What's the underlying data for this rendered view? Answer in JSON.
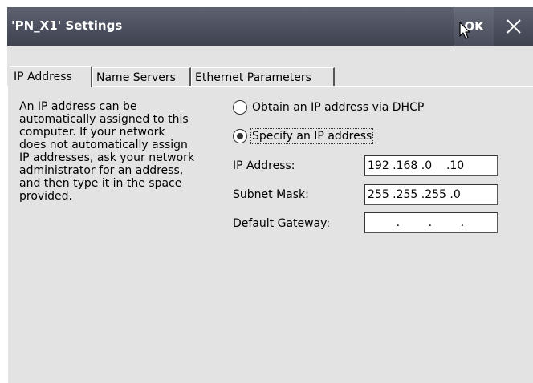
{
  "window": {
    "title": "'PN_X1' Settings",
    "ok_label": "OK",
    "close_icon": "close-icon"
  },
  "tabs": [
    {
      "label": "IP Address",
      "active": true
    },
    {
      "label": "Name Servers",
      "active": false
    },
    {
      "label": "Ethernet Parameters",
      "active": false
    }
  ],
  "description": {
    "lines": [
      "An IP address can be",
      "automatically assigned to this",
      "computer.  If your network",
      "does not automatically assign",
      "IP addresses, ask your network",
      "administrator for an address,",
      "and then type it in the space",
      "provided."
    ]
  },
  "options": {
    "dhcp": {
      "label": "Obtain an IP address via DHCP",
      "selected": false
    },
    "manual": {
      "label": "Specify an IP address",
      "selected": true
    }
  },
  "fields": {
    "ip": {
      "label": "IP Address:",
      "value": "192 .168 .0    .10"
    },
    "subnet": {
      "label": "Subnet Mask:",
      "value": "255 .255 .255 .0"
    },
    "gateway": {
      "label": "Default Gateway:",
      "value": "        .        .        ."
    }
  },
  "colors": {
    "titlebar": "#4a4d5b",
    "panel": "#e3e3e3"
  }
}
